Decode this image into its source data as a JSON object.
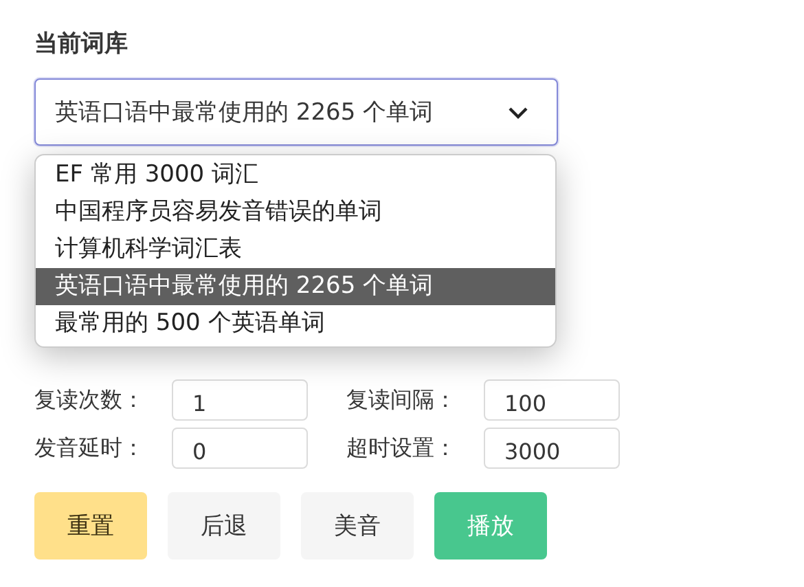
{
  "library": {
    "label": "当前词库",
    "value": "英语口语中最常使用的 2265 个单词",
    "expanded": true,
    "options": [
      {
        "label": "EF 常用 3000 词汇",
        "selected": false
      },
      {
        "label": "中国程序员容易发音错误的单词",
        "selected": false
      },
      {
        "label": "计算机科学词汇表",
        "selected": false
      },
      {
        "label": "英语口语中最常使用的 2265 个单词",
        "selected": true
      },
      {
        "label": "最常用的 500 个英语单词",
        "selected": false
      }
    ]
  },
  "settings": [
    {
      "label": "复读次数：",
      "value": "1"
    },
    {
      "label": "复读间隔：",
      "value": "100"
    },
    {
      "label": "发音延时：",
      "value": "0"
    },
    {
      "label": "超时设置：",
      "value": "3000"
    }
  ],
  "buttons": [
    {
      "label": "重置",
      "kind": "warning"
    },
    {
      "label": "后退",
      "kind": "plain"
    },
    {
      "label": "美音",
      "kind": "plain"
    },
    {
      "label": "播放",
      "kind": "primary"
    }
  ]
}
